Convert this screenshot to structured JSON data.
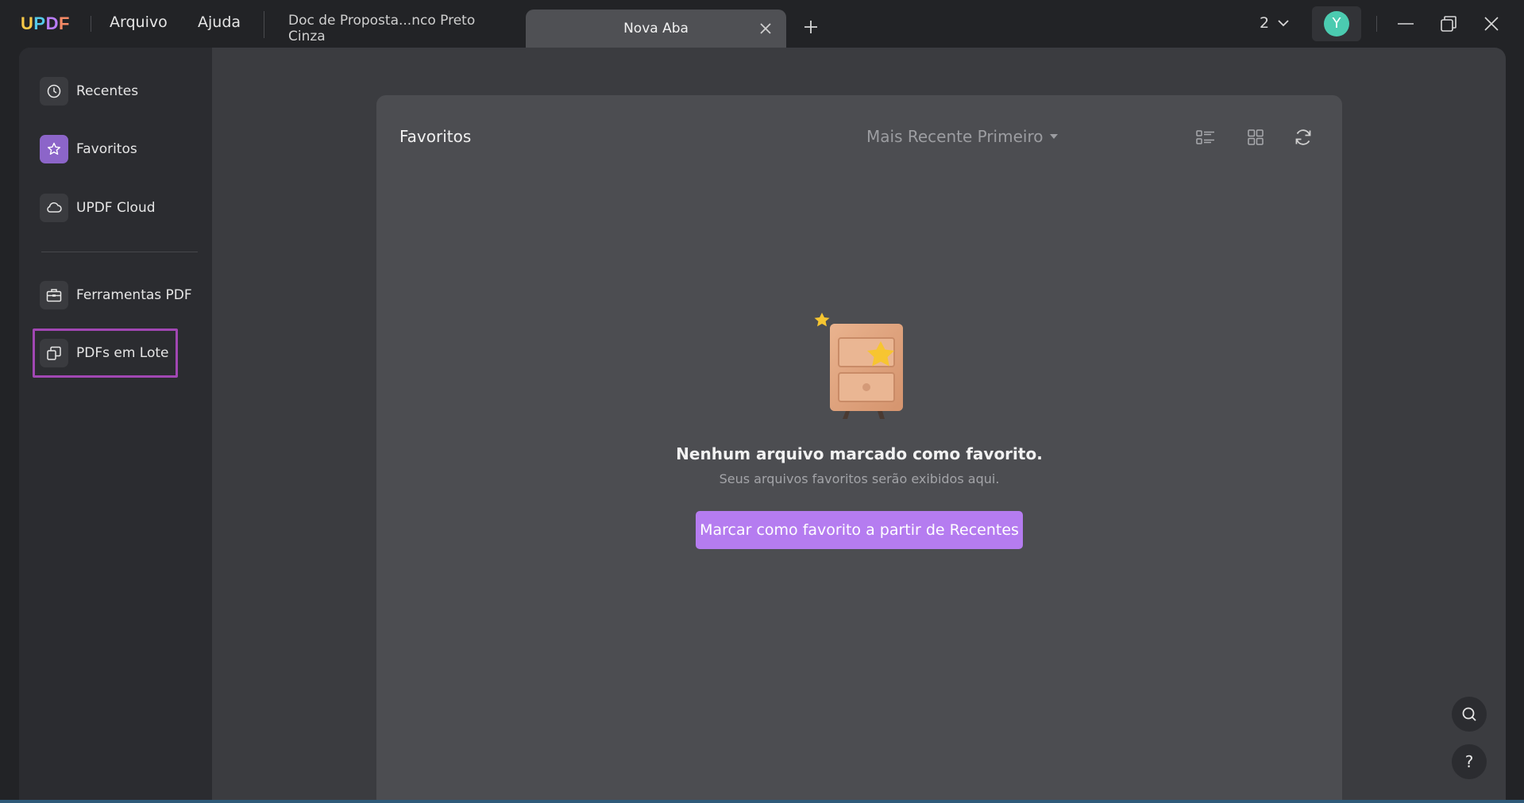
{
  "app": {
    "logo_letters": [
      "U",
      "P",
      "D",
      "F"
    ],
    "menu": {
      "file": "Arquivo",
      "help": "Ajuda"
    }
  },
  "tabs": [
    {
      "label": "Doc de Proposta...nco Preto Cinza",
      "active": false
    },
    {
      "label": "Nova Aba",
      "active": true
    }
  ],
  "titlebar": {
    "tab_count": "2",
    "avatar_initial": "Y"
  },
  "sidebar": {
    "items": [
      {
        "label": "Recentes",
        "icon": "clock-icon"
      },
      {
        "label": "Favoritos",
        "icon": "star-icon",
        "active": true
      },
      {
        "label": "UPDF Cloud",
        "icon": "cloud-icon"
      },
      {
        "label": "Ferramentas PDF",
        "icon": "toolbox-icon"
      },
      {
        "label": "PDFs em Lote",
        "icon": "batch-copy-icon",
        "highlighted": true
      }
    ]
  },
  "content": {
    "title": "Favoritos",
    "sort_label": "Mais Recente Primeiro",
    "empty_title": "Nenhum arquivo marcado como favorito.",
    "empty_subtitle": "Seus arquivos favoritos serão exibidos aqui.",
    "cta_label": "Marcar como favorito a partir de Recentes"
  },
  "floating": {
    "help_label": "?"
  },
  "colors": {
    "accent": "#b57cf0",
    "highlight_border": "#a147b3",
    "avatar": "#4bcbb0"
  }
}
